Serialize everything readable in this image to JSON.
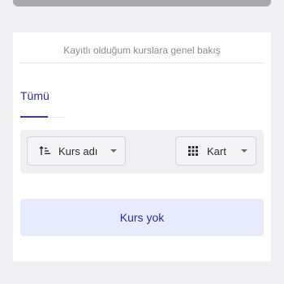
{
  "header": {
    "subtitle": "Kayıtlı olduğum kurslara genel bakış"
  },
  "tabs": [
    {
      "label": "Tümü",
      "active": true
    }
  ],
  "toolbar": {
    "sort": {
      "label": "Kurs adı",
      "icon": "sort-ascending-icon"
    },
    "view": {
      "label": "Kart",
      "icon": "grid-icon"
    }
  },
  "empty_state": {
    "message": "Kurs yok"
  },
  "colors": {
    "accent": "#2e2ba0",
    "empty_bg": "#e8ebfb",
    "page_bg": "#f0f0f3"
  }
}
